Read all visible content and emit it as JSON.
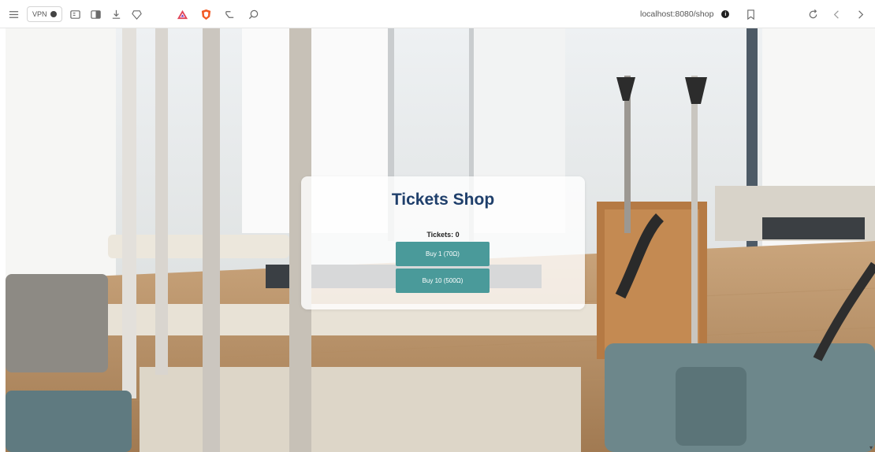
{
  "browser": {
    "vpn_label": "VPN",
    "url": "localhost:8080/shop",
    "icons": [
      "menu-icon",
      "vpn-icon",
      "sidebar-icon",
      "split-view-icon",
      "download-icon",
      "rewards-icon",
      "brave-aurora-icon",
      "brave-shields-icon",
      "share-icon",
      "search-icon",
      "site-info-icon",
      "bookmark-icon",
      "reload-icon",
      "back-icon",
      "forward-icon"
    ]
  },
  "shop": {
    "title": "Tickets Shop",
    "tickets_label": "Tickets: 0",
    "buy_one_label": "Buy 1 (70Ω)",
    "buy_ten_label": "Buy 10 (500Ω)",
    "button_color": "#4a9a9a",
    "title_color": "#1f3f6b"
  },
  "background": {
    "image_subject": "pilates-studio-photo"
  }
}
